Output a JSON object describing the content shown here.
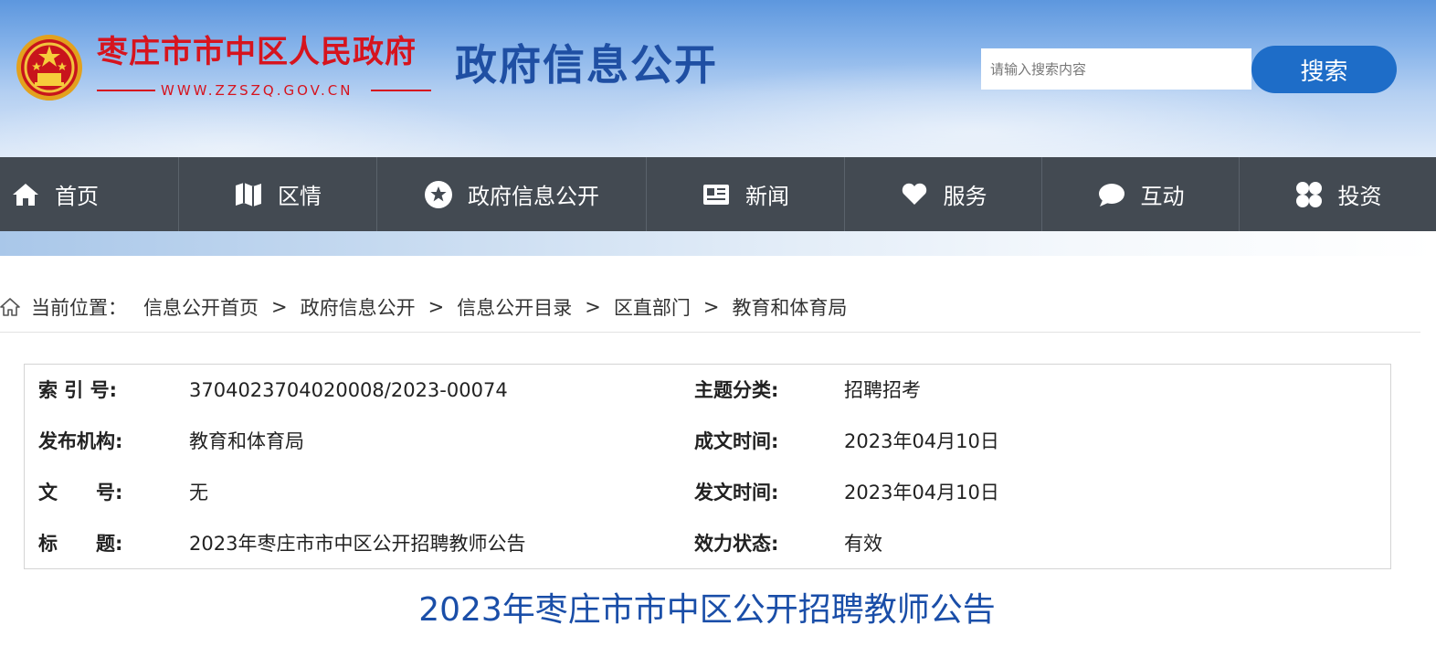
{
  "header": {
    "site_name": "枣庄市市中区人民政府",
    "site_url": "WWW.ZZSZQ.GOV.CN",
    "section_title": "政府信息公开",
    "search": {
      "placeholder": "请输入搜索内容",
      "button_label": "搜索"
    }
  },
  "nav": {
    "items": [
      {
        "label": "首页",
        "icon": "home-icon"
      },
      {
        "label": "区情",
        "icon": "map-icon"
      },
      {
        "label": "政府信息公开",
        "icon": "star-circle-icon"
      },
      {
        "label": "新闻",
        "icon": "newspaper-icon"
      },
      {
        "label": "服务",
        "icon": "heart-hand-icon"
      },
      {
        "label": "互动",
        "icon": "chat-bubble-icon"
      },
      {
        "label": "投资",
        "icon": "grid-petals-icon"
      }
    ]
  },
  "breadcrumb": {
    "prefix": "当前位置：",
    "separator": ">",
    "items": [
      "信息公开首页",
      "政府信息公开",
      "信息公开目录",
      "区直部门",
      "教育和体育局"
    ]
  },
  "meta": {
    "rows": [
      {
        "label_left": "索 引 号:",
        "value_left": "3704023704020008/2023-00074",
        "label_right": "主题分类:",
        "value_right": "招聘招考"
      },
      {
        "label_left": "发布机构:",
        "value_left": "教育和体育局",
        "label_right": "成文时间:",
        "value_right": "2023年04月10日"
      },
      {
        "label_left": "文　　号:",
        "value_left": "无",
        "label_right": "发文时间:",
        "value_right": "2023年04月10日"
      },
      {
        "label_left": "标　　题:",
        "value_left": "2023年枣庄市市中区公开招聘教师公告",
        "label_right": "效力状态:",
        "value_right": "有效"
      }
    ]
  },
  "article": {
    "title": "2023年枣庄市市中区公开招聘教师公告"
  },
  "colors": {
    "brand_red": "#d6141e",
    "title_blue": "#1f4fa3",
    "nav_bg": "#434a52",
    "button_blue": "#1e6dc8",
    "article_title": "#1a4ea8"
  }
}
